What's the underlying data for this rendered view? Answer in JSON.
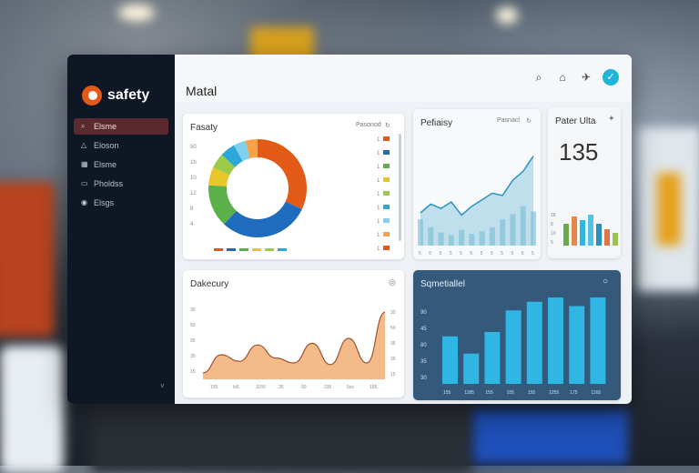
{
  "colors": {
    "sidebar": "#0f1725",
    "accent": "#e35a16",
    "teal": "#1fb5d8",
    "bar_blue": "#2fb6e3",
    "area_fill": "#f4bb8a"
  },
  "brand": {
    "name": "safety",
    "logo_icon": "safety-logo-icon"
  },
  "sidebar": {
    "items": [
      {
        "label": "Elsme",
        "icon": "search-icon",
        "active": true
      },
      {
        "label": "Eloson",
        "icon": "alert-icon",
        "active": false
      },
      {
        "label": "Elsme",
        "icon": "grid-icon",
        "active": false
      },
      {
        "label": "Pholdss",
        "icon": "folder-icon",
        "active": false
      },
      {
        "label": "Elsgs",
        "icon": "user-icon",
        "active": false
      }
    ],
    "collapse_glyph": "˅"
  },
  "header": {
    "title": "Matal",
    "icons": [
      "search-icon",
      "home-icon",
      "bird-icon",
      "check-icon"
    ]
  },
  "donut_card": {
    "title": "Fasaty",
    "meta": "Pasonod",
    "chart_data": {
      "type": "pie",
      "donut": true,
      "values": [
        32,
        30,
        14,
        6,
        5,
        5,
        4,
        4
      ],
      "colors": [
        "#e35a16",
        "#1f6bbd",
        "#5bb04a",
        "#e9c62a",
        "#9ccc47",
        "#2aa8d8",
        "#7ed0ee",
        "#f7a24a"
      ],
      "left_ticks": [
        "50",
        "1b",
        "10",
        "12",
        "8",
        "4"
      ],
      "right_ticks": [
        "1",
        "1",
        "1",
        "1",
        "1",
        "1",
        "1",
        "1",
        "1"
      ]
    }
  },
  "area_card": {
    "title": "Pefiaisy",
    "meta": "Pasnacl",
    "chart_data": {
      "type": "area",
      "values": [
        30,
        38,
        34,
        40,
        28,
        36,
        42,
        48,
        46,
        60,
        68,
        82
      ],
      "bars": [
        20,
        14,
        10,
        8,
        12,
        9,
        11,
        14,
        20,
        24,
        30,
        26
      ],
      "x_ticks": [
        "5",
        "5",
        "5",
        "5",
        "5",
        "5",
        "5",
        "5",
        "5",
        "5",
        "5",
        "5"
      ]
    }
  },
  "kpi_card": {
    "title": "Pater Ulta",
    "value": "135",
    "chart_data": {
      "type": "bar",
      "values": [
        60,
        80,
        70,
        85,
        60,
        45,
        35
      ],
      "colors": [
        "#6aa94c",
        "#e08850",
        "#2fb6e3",
        "#55c0e8",
        "#2a8fbf",
        "#e0754a",
        "#9bc34f"
      ],
      "y_ticks": [
        "18",
        "8",
        "10",
        "5"
      ]
    }
  },
  "wave_card": {
    "title": "Dakecury",
    "chart_data": {
      "type": "area",
      "values": [
        8,
        30,
        22,
        42,
        26,
        20,
        44,
        18,
        50,
        20,
        82
      ],
      "y_ticks": [
        "30",
        "50",
        "35",
        "30",
        "15"
      ],
      "x_ticks": [
        "155",
        "ls5",
        "1155",
        "35",
        "50",
        "235",
        "5ss",
        "155"
      ]
    }
  },
  "bars_card": {
    "title": "Sqmetiallel",
    "chart_data": {
      "type": "bar",
      "values": [
        55,
        35,
        60,
        85,
        95,
        100,
        90,
        100
      ],
      "y_ticks": [
        "90",
        "45",
        "80",
        "35",
        "30"
      ],
      "x_ticks": [
        "155",
        "1185",
        "155",
        "155",
        "155",
        "1255",
        "175",
        "1165"
      ]
    }
  }
}
